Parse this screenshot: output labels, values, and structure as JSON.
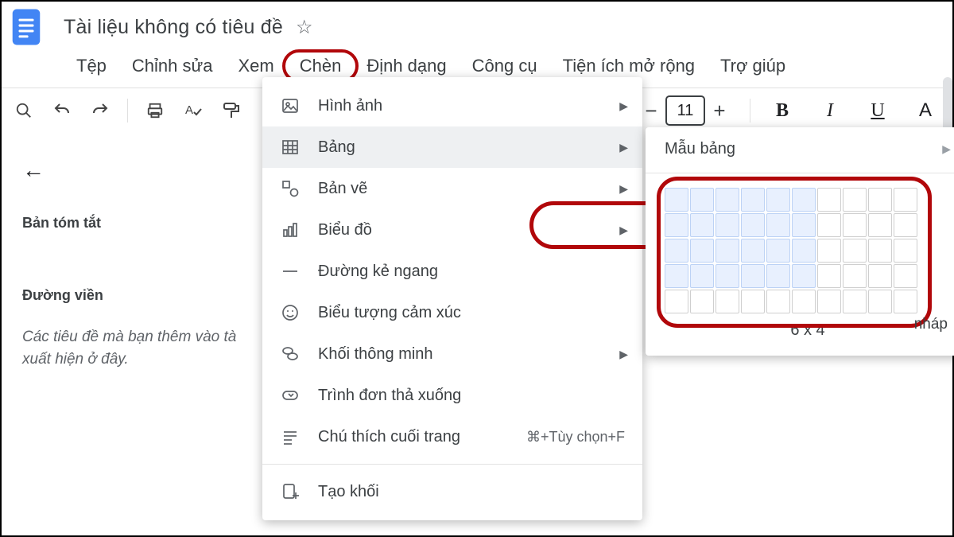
{
  "doc": {
    "title": "Tài liệu không có tiêu đề"
  },
  "menubar": {
    "file": "Tệp",
    "edit": "Chỉnh sửa",
    "view": "Xem",
    "insert": "Chèn",
    "format": "Định dạng",
    "tools": "Công cụ",
    "extensions": "Tiện ích mở rộng",
    "help": "Trợ giúp"
  },
  "toolbar": {
    "font_size": "11"
  },
  "outline": {
    "summary": "Bản tóm tắt",
    "border": "Đường viền",
    "placeholder": "Các tiêu đề mà bạn thêm vào tà\nxuất hiện ở đây."
  },
  "insert_menu": {
    "image": "Hình ảnh",
    "table": "Bảng",
    "drawing": "Bản vẽ",
    "chart": "Biểu đồ",
    "hrule": "Đường kẻ ngang",
    "emoji": "Biểu tượng cảm xúc",
    "smartblock": "Khối thông minh",
    "dropdown": "Trình đơn thả xuống",
    "footnote": "Chú thích cuối trang",
    "footnote_shortcut": "⌘+Tùy chọn+F",
    "create_block": "Tạo khối"
  },
  "table_sub": {
    "templates": "Mẫu bảng",
    "selection_label": "6 x 4",
    "cols_selected": 6,
    "rows_selected": 4,
    "grid_cols": 10,
    "grid_rows": 5
  },
  "fragment": "nháp"
}
